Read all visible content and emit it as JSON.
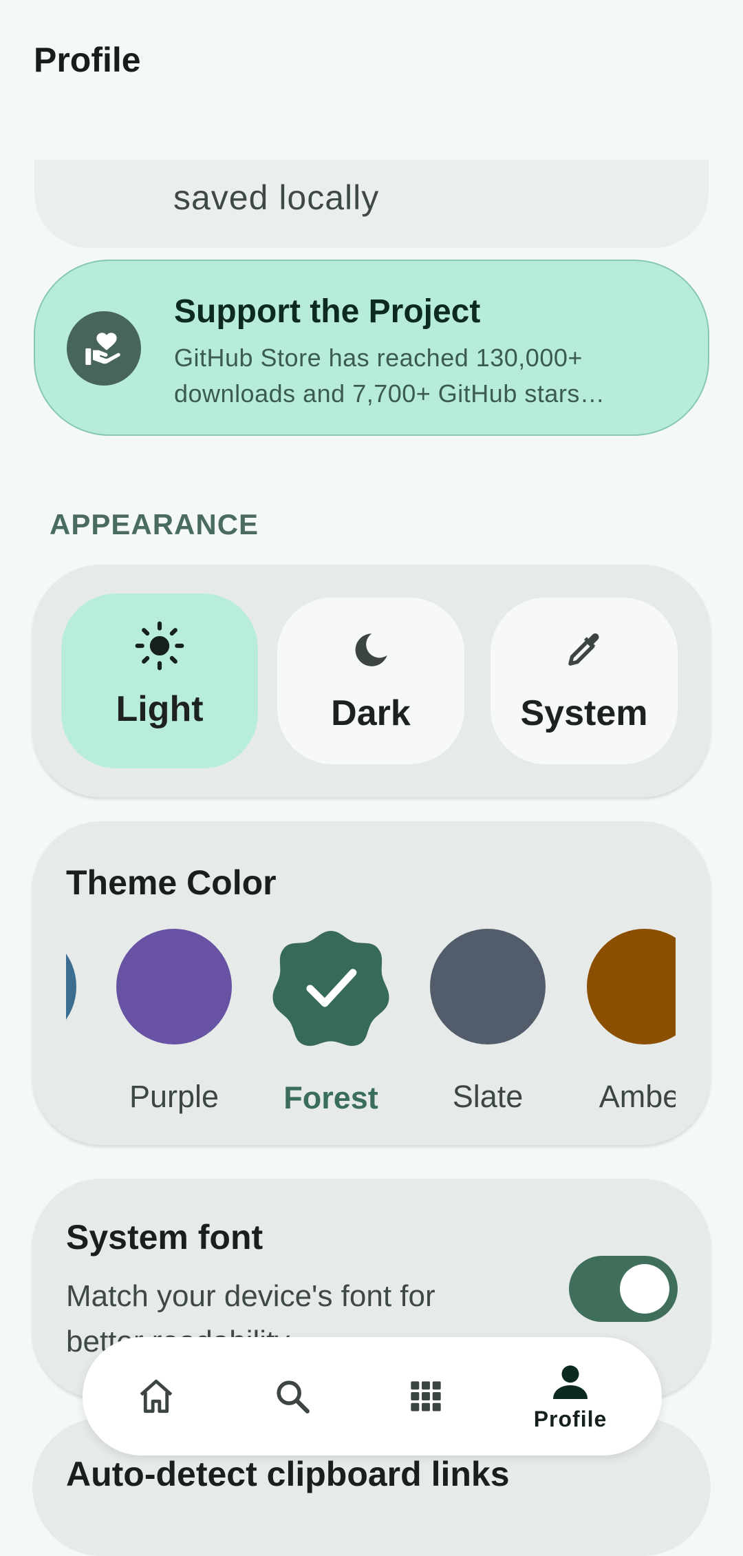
{
  "header": {
    "title": "Profile"
  },
  "clipped_card": {
    "text": "saved locally"
  },
  "support": {
    "title": "Support the Project",
    "description": "GitHub Store has reached 130,000+ downloads and 7,700+ GitHub stars…",
    "icon": "hand-heart-icon"
  },
  "appearance": {
    "section_label": "APPEARANCE",
    "modes": [
      {
        "label": "Light",
        "icon": "sun-icon",
        "selected": true
      },
      {
        "label": "Dark",
        "icon": "moon-icon",
        "selected": false
      },
      {
        "label": "System",
        "icon": "eyedropper-icon",
        "selected": false
      }
    ]
  },
  "theme": {
    "title": "Theme Color",
    "colors": [
      {
        "name": "",
        "color": "#3a6d8f",
        "selected": false
      },
      {
        "name": "Purple",
        "color": "#6852a3",
        "selected": false
      },
      {
        "name": "Forest",
        "color": "#376a58",
        "selected": true
      },
      {
        "name": "Slate",
        "color": "#525c6b",
        "selected": false
      },
      {
        "name": "Amber",
        "color": "#8a4f00",
        "selected": false
      }
    ]
  },
  "system_font": {
    "title": "System font",
    "description": "Match your device's font for better readability",
    "enabled": true
  },
  "next_card": {
    "title": "Auto-detect clipboard links"
  },
  "navbar": {
    "items": [
      {
        "icon": "home-icon",
        "label": ""
      },
      {
        "icon": "search-icon",
        "label": ""
      },
      {
        "icon": "apps-grid-icon",
        "label": ""
      },
      {
        "icon": "person-icon",
        "label": "Profile",
        "selected": true
      }
    ]
  }
}
